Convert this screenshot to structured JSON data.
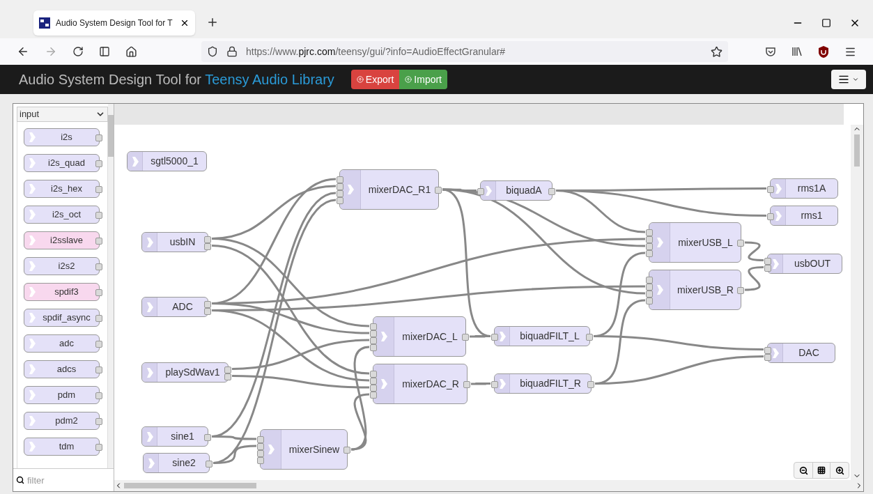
{
  "browser": {
    "tab_title": "Audio System Design Tool for T",
    "url": {
      "prefix": "https://www.",
      "domain": "pjrc.com",
      "path": "/teensy/gui/?info=AudioEffectGranular#"
    }
  },
  "header": {
    "title": "Audio System Design Tool for ",
    "title_link": "Teensy Audio Library",
    "buttons": [
      "Export",
      "Import"
    ]
  },
  "palette": {
    "category": "input",
    "filter_placeholder": "filter",
    "items": [
      {
        "label": "i2s",
        "color": "#e4e1f8"
      },
      {
        "label": "i2s_quad",
        "color": "#e4e1f8"
      },
      {
        "label": "i2s_hex",
        "color": "#e4e1f8"
      },
      {
        "label": "i2s_oct",
        "color": "#e4e1f8"
      },
      {
        "label": "i2sslave",
        "color": "#f8d8ee"
      },
      {
        "label": "i2s2",
        "color": "#e4e1f8"
      },
      {
        "label": "spdif3",
        "color": "#f8d8ee"
      },
      {
        "label": "spdif_async",
        "color": "#e4e1f8"
      },
      {
        "label": "adc",
        "color": "#e4e1f8"
      },
      {
        "label": "adcs",
        "color": "#e4e1f8"
      },
      {
        "label": "pdm",
        "color": "#e4e1f8"
      },
      {
        "label": "pdm2",
        "color": "#e4e1f8"
      },
      {
        "label": "tdm",
        "color": "#e4e1f8"
      }
    ]
  },
  "nodes": [
    {
      "label": "sgtl5000_1"
    },
    {
      "label": "usbIN"
    },
    {
      "label": "ADC"
    },
    {
      "label": "playSdWav1"
    },
    {
      "label": "sine1"
    },
    {
      "label": "sine2"
    },
    {
      "label": "mixerSinew"
    },
    {
      "label": "mixerDAC_R1"
    },
    {
      "label": "biquadA"
    },
    {
      "label": "mixerDAC_L"
    },
    {
      "label": "mixerDAC_R"
    },
    {
      "label": "biquadFILT_L"
    },
    {
      "label": "biquadFILT_R"
    },
    {
      "label": "rms1A"
    },
    {
      "label": "rms1"
    },
    {
      "label": "mixerUSB_L"
    },
    {
      "label": "mixerUSB_R"
    },
    {
      "label": "usbOUT"
    },
    {
      "label": "DAC"
    }
  ]
}
